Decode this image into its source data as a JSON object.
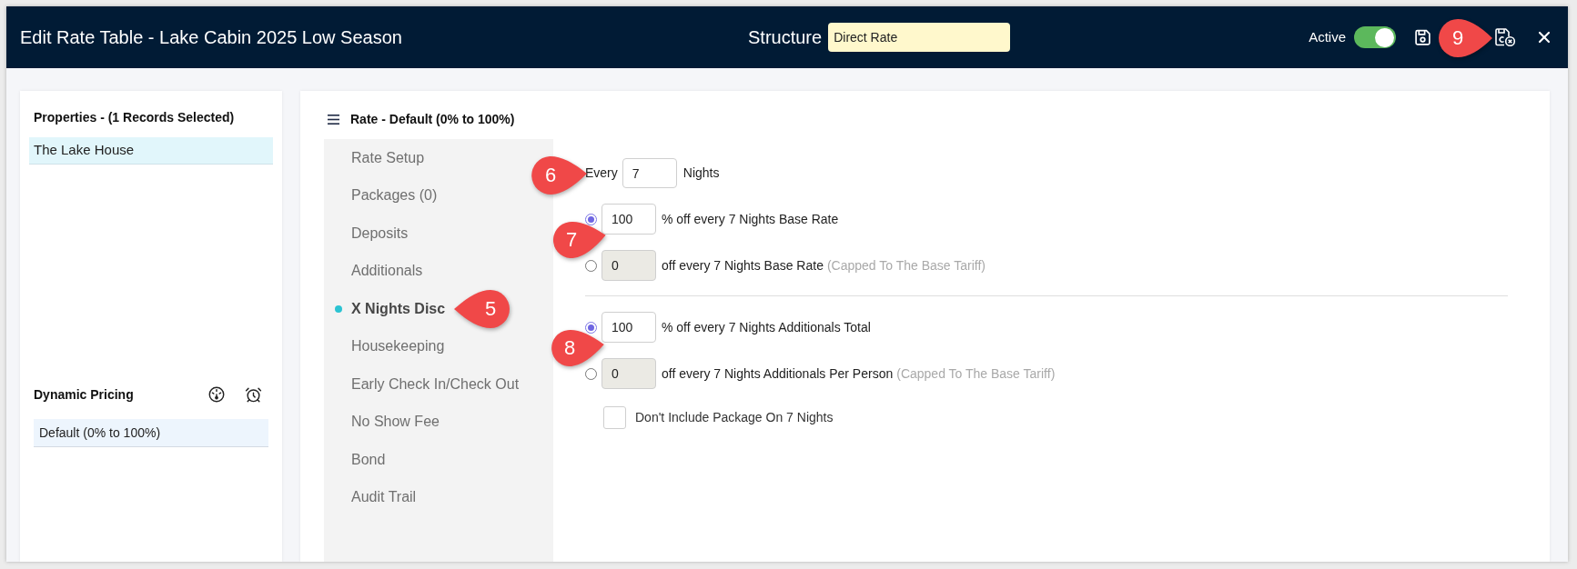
{
  "header": {
    "title": "Edit Rate Table - Lake Cabin 2025 Low Season",
    "structure": {
      "label": "Structure",
      "value": "Direct Rate"
    },
    "active": {
      "label": "Active",
      "on": true
    },
    "callout": "9"
  },
  "properties": {
    "title": "Properties - (1 Records Selected)",
    "items": [
      {
        "label": "The Lake House",
        "selected": true
      }
    ]
  },
  "dynamic_pricing": {
    "title": "Dynamic Pricing",
    "items": [
      {
        "label": "Default (0% to 100%)",
        "selected": true
      }
    ]
  },
  "rate": {
    "title": "Rate - Default (0% to 100%)",
    "menu": [
      {
        "label": "Rate Setup",
        "selected": false
      },
      {
        "label": "Packages (0)",
        "selected": false
      },
      {
        "label": "Deposits",
        "selected": false
      },
      {
        "label": "Additionals",
        "selected": false
      },
      {
        "label": "X Nights Disc",
        "selected": true,
        "callout": "5"
      },
      {
        "label": "Housekeeping",
        "selected": false
      },
      {
        "label": "Early Check In/Check Out",
        "selected": false
      },
      {
        "label": "No Show Fee",
        "selected": false
      },
      {
        "label": "Bond",
        "selected": false
      },
      {
        "label": "Audit Trail",
        "selected": false
      }
    ]
  },
  "form": {
    "every": {
      "label": "Every",
      "value": "7",
      "unit": "Nights",
      "callout": "6"
    },
    "base_rate": {
      "callout": "7",
      "options": [
        {
          "value": "100",
          "label": "% off every 7 Nights Base Rate",
          "selected": true,
          "disabled": false
        },
        {
          "value": "0",
          "label": "off every 7 Nights Base Rate",
          "note": "(Capped To The Base Tariff)",
          "selected": false,
          "disabled": true
        }
      ]
    },
    "additionals": {
      "callout": "8",
      "options": [
        {
          "value": "100",
          "label": "% off every 7 Nights Additionals Total",
          "selected": true,
          "disabled": false
        },
        {
          "value": "0",
          "label": "off every 7 Nights Additionals Per Person",
          "note": "(Capped To The Base Tariff)",
          "selected": false,
          "disabled": true
        }
      ]
    },
    "exclude_package": {
      "label": "Don't Include Package On 7 Nights",
      "checked": false
    }
  }
}
